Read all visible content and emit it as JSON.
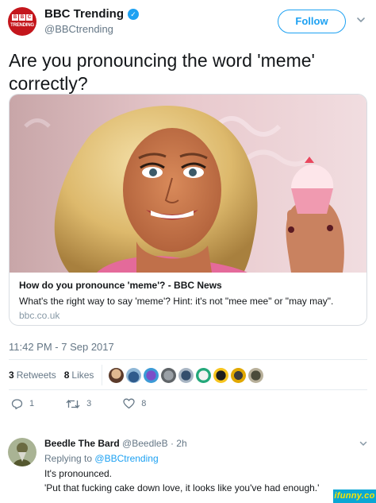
{
  "tweet": {
    "author": {
      "name": "BBC Trending",
      "handle": "@BBCtrending",
      "avatar_lettering": "BBC TRENDING",
      "verified": true
    },
    "follow_label": "Follow",
    "text": "Are you pronouncing the word 'meme' correctly?",
    "card": {
      "title": "How do you pronounce 'meme'? - BBC News",
      "description": "What's the right way to say 'meme'? Hint: it's not \"mee mee\" or \"may may\".",
      "domain": "bbc.co.uk"
    },
    "timestamp": "11:42 PM - 7 Sep 2017",
    "stats": {
      "retweets_count": "3",
      "retweets_label": "Retweets",
      "likes_count": "8",
      "likes_label": "Likes"
    },
    "actions": {
      "reply_count": "1",
      "retweet_count": "3",
      "like_count": "8"
    }
  },
  "reply": {
    "author_name": "Beedle The Bard",
    "handle": "@BeedleB",
    "separator": "·",
    "time": "2h",
    "replying_to_prefix": "Replying to",
    "replying_to_handle": "@BBCtrending",
    "lines": [
      "It's pronounced.",
      "'Put that fucking cake down love, it looks like you've had enough.'"
    ]
  },
  "watermark_text": "ifunny.co",
  "colors": {
    "accent": "#1da1f2",
    "bbc_red": "#c4161c",
    "muted_text": "#657786",
    "watermark_bg": "#0aa7d4",
    "watermark_text": "#ffe400"
  },
  "icons": [
    "verified-badge-icon",
    "chevron-down-icon",
    "reply-icon",
    "retweet-icon",
    "like-icon"
  ]
}
